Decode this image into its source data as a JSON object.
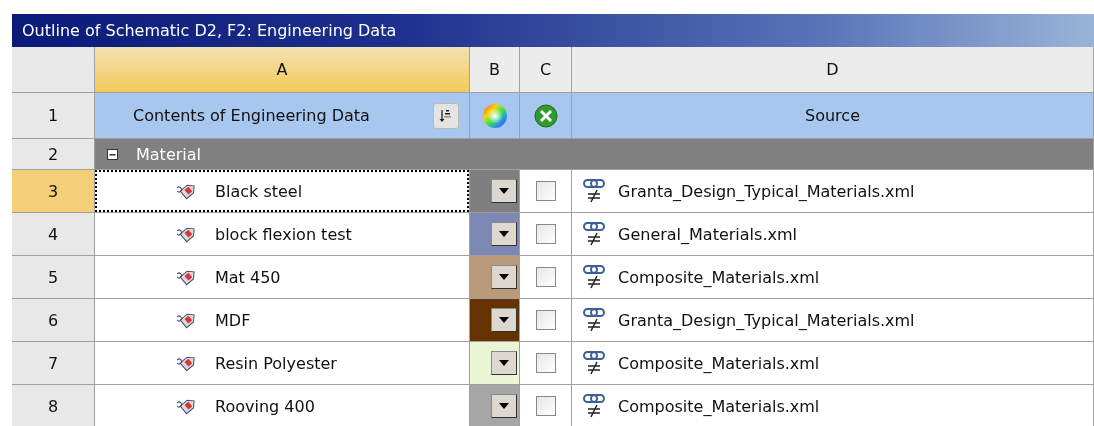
{
  "window": {
    "title": "Outline of Schematic D2, F2: Engineering Data"
  },
  "columns": [
    "A",
    "B",
    "C",
    "D"
  ],
  "header_row": {
    "number": "1",
    "label": "Contents of Engineering Data",
    "source_label": "Source"
  },
  "group_row": {
    "number": "2",
    "label": "Material",
    "expanded": true
  },
  "rows": [
    {
      "number": "3",
      "name": "Black steel",
      "color": "#7f7f7f",
      "checked": false,
      "selected": true,
      "source": "Granta_Design_Typical_Materials.xml"
    },
    {
      "number": "4",
      "name": "block flexion test",
      "color": "#7d87b3",
      "checked": false,
      "selected": false,
      "source": "General_Materials.xml"
    },
    {
      "number": "5",
      "name": "Mat 450",
      "color": "#b99a7b",
      "checked": false,
      "selected": false,
      "source": "Composite_Materials.xml"
    },
    {
      "number": "6",
      "name": "MDF",
      "color": "#663300",
      "checked": false,
      "selected": false,
      "source": "Granta_Design_Typical_Materials.xml"
    },
    {
      "number": "7",
      "name": "Resin Polyester",
      "color": "#e9f5d5",
      "checked": false,
      "selected": false,
      "source": "Composite_Materials.xml"
    },
    {
      "number": "8",
      "name": "Rooving 400",
      "color": "#a6a6a6",
      "checked": false,
      "selected": false,
      "source": "Composite_Materials.xml"
    }
  ]
}
